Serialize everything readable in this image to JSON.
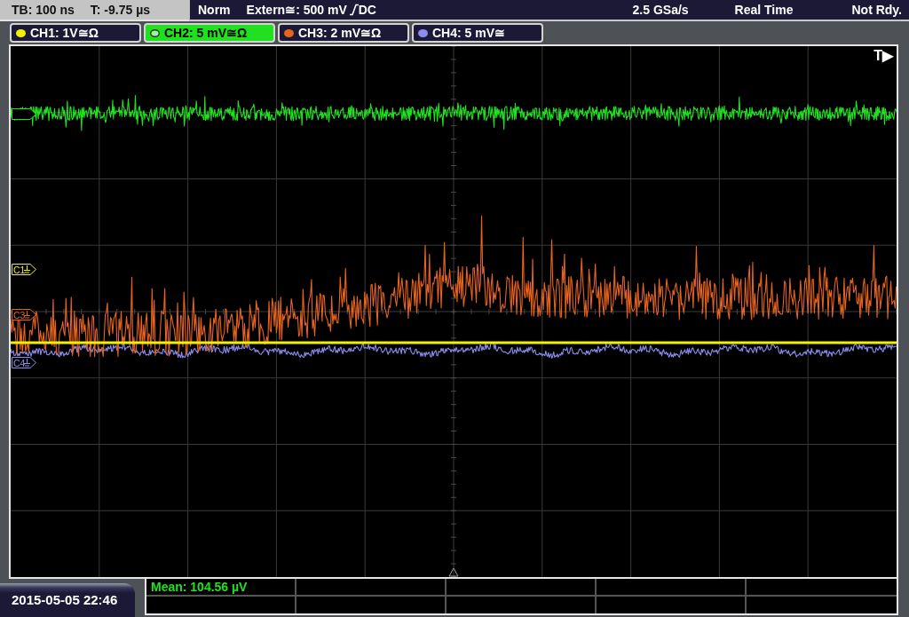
{
  "header": {
    "timebase": "TB: 100 ns",
    "trigger_time": "T: -9.75 µs",
    "trigger_mode": "Norm",
    "trigger_source": "Extern≅: 500 mV",
    "trigger_coupling": "DC",
    "sample_rate": "2.5 GSa/s",
    "acquisition_mode": "Real Time",
    "status": "Not Rdy."
  },
  "channels": [
    {
      "label": "CH1: 1V≅Ω",
      "color": "#f0f000",
      "selected": false,
      "marker": "C1"
    },
    {
      "label": "CH2: 5 mV≅Ω",
      "color": "#20e020",
      "selected": true
    },
    {
      "label": "CH3: 2 mV≅Ω",
      "color": "#e8641e",
      "selected": false,
      "marker": "C3"
    },
    {
      "label": "CH4: 5 mV≅",
      "color": "#8c8cf0",
      "selected": false,
      "marker": "C4"
    }
  ],
  "screen": {
    "trigger_marker": "T▶"
  },
  "measurements": [
    "Mean: 104.56 µV"
  ],
  "timestamp": "2015-05-05 22:46"
}
